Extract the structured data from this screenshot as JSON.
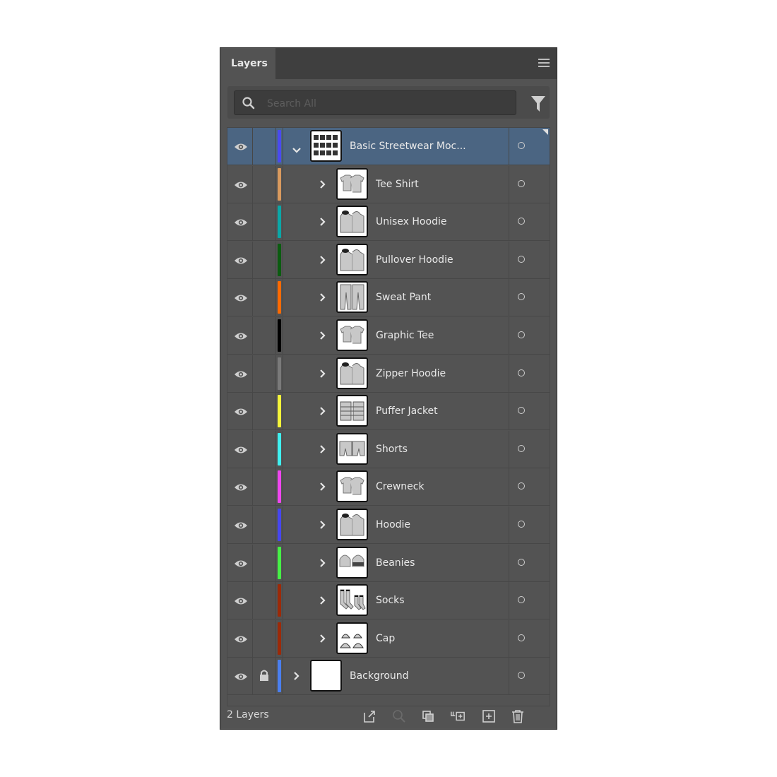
{
  "panel": {
    "tab_label": "Layers",
    "menu_icon": "hamburger-menu-icon",
    "search": {
      "placeholder": "Search All",
      "value": ""
    },
    "filter_icon": "filter-funnel-icon"
  },
  "layers": [
    {
      "name": "Basic Streetwear Moc...",
      "color": "#4a4af0",
      "expanded": true,
      "level": 0,
      "selected": true,
      "locked": false,
      "visible": true,
      "thumb": "grid"
    },
    {
      "name": "Tee Shirt",
      "color": "#d99a5e",
      "expanded": false,
      "level": 1,
      "visible": true,
      "locked": false,
      "thumb": "tee"
    },
    {
      "name": "Unisex Hoodie",
      "color": "#0aa7a7",
      "expanded": false,
      "level": 1,
      "visible": true,
      "locked": false,
      "thumb": "hoodie"
    },
    {
      "name": "Pullover Hoodie",
      "color": "#0b5c10",
      "expanded": false,
      "level": 1,
      "visible": true,
      "locked": false,
      "thumb": "hoodie"
    },
    {
      "name": "Sweat Pant",
      "color": "#ff6a00",
      "expanded": false,
      "level": 1,
      "visible": true,
      "locked": false,
      "thumb": "pant"
    },
    {
      "name": "Graphic Tee",
      "color": "#000000",
      "expanded": false,
      "level": 1,
      "visible": true,
      "locked": false,
      "thumb": "tee"
    },
    {
      "name": "Zipper Hoodie",
      "color": "#7a7a7a",
      "expanded": false,
      "level": 1,
      "visible": true,
      "locked": false,
      "thumb": "hoodie"
    },
    {
      "name": "Puffer Jacket",
      "color": "#f5f53a",
      "expanded": false,
      "level": 1,
      "visible": true,
      "locked": false,
      "thumb": "jacket"
    },
    {
      "name": "Shorts",
      "color": "#3ff0f0",
      "expanded": false,
      "level": 1,
      "visible": true,
      "locked": false,
      "thumb": "shorts"
    },
    {
      "name": "Crewneck",
      "color": "#f046f0",
      "expanded": false,
      "level": 1,
      "visible": true,
      "locked": false,
      "thumb": "tee"
    },
    {
      "name": "Hoodie",
      "color": "#4646f0",
      "expanded": false,
      "level": 1,
      "visible": true,
      "locked": false,
      "thumb": "hoodie"
    },
    {
      "name": "Beanies",
      "color": "#46f046",
      "expanded": false,
      "level": 1,
      "visible": true,
      "locked": false,
      "thumb": "beanie"
    },
    {
      "name": "Socks",
      "color": "#9c2a08",
      "expanded": false,
      "level": 1,
      "visible": true,
      "locked": false,
      "thumb": "socks"
    },
    {
      "name": "Cap",
      "color": "#9c2a08",
      "expanded": false,
      "level": 1,
      "visible": true,
      "locked": false,
      "thumb": "cap"
    },
    {
      "name": "Background",
      "color": "#4a7ff0",
      "expanded": false,
      "level": 0,
      "visible": true,
      "locked": true,
      "thumb": "blank"
    }
  ],
  "footer": {
    "layer_count": "2 Layers",
    "buttons": [
      {
        "name": "export-icon"
      },
      {
        "name": "locate-object-icon"
      },
      {
        "name": "make-clipping-mask-icon"
      },
      {
        "name": "create-sublayer-icon"
      },
      {
        "name": "create-new-layer-icon"
      },
      {
        "name": "delete-layer-icon"
      }
    ]
  }
}
